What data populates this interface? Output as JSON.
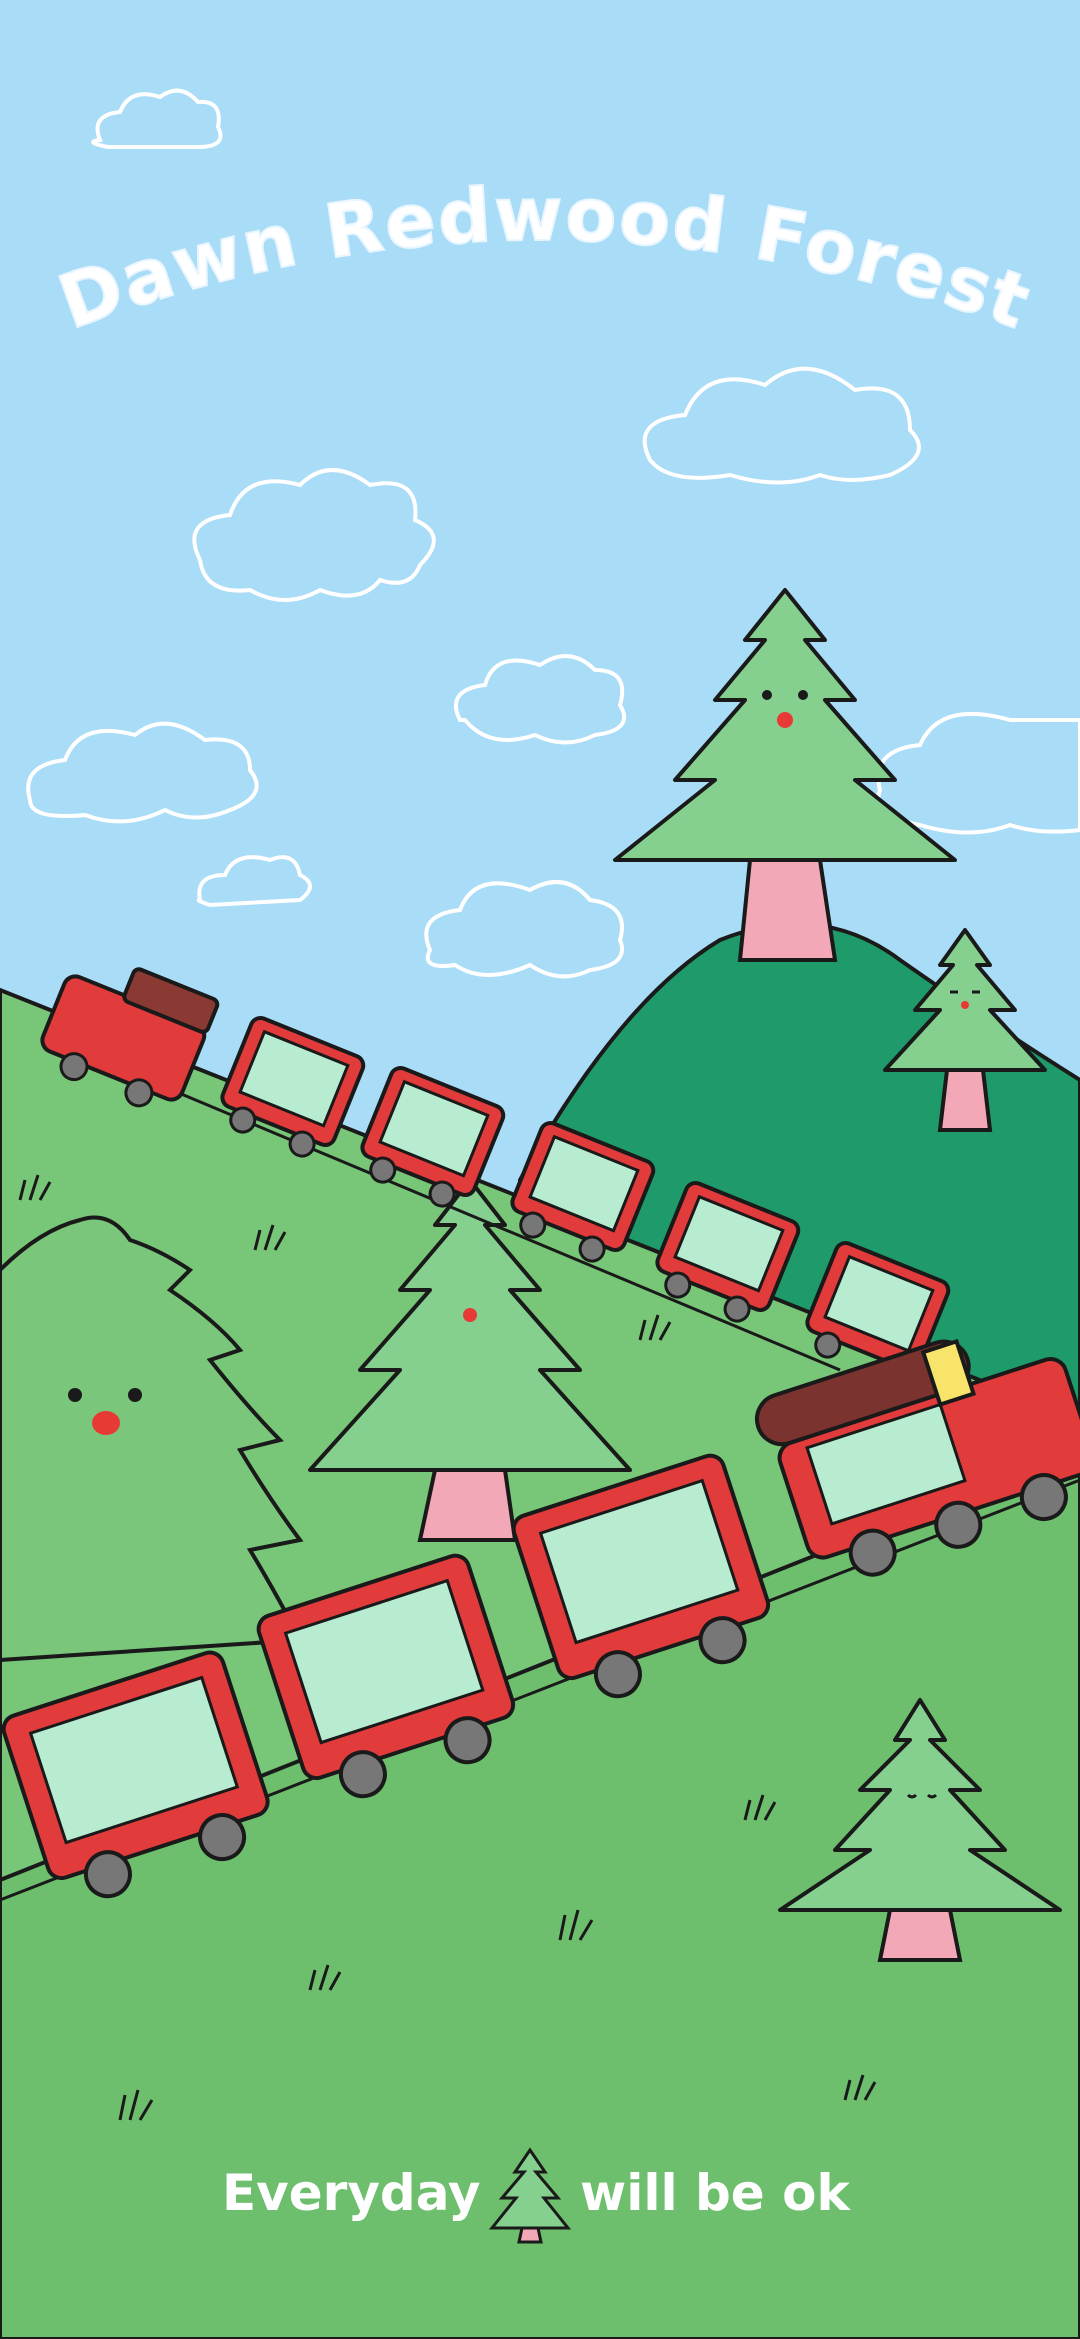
{
  "title": "Dawn Redwood Forest",
  "footer": {
    "left_text": "Everyday",
    "right_text": "will be ok"
  },
  "colors": {
    "sky": "#a9dcf7",
    "hill_light": "#78c677",
    "hill_dark": "#1f9a6a",
    "ground": "#6dbf6e",
    "tree_green": "#86d08f",
    "tree_trunk": "#f2a8b6",
    "train_red": "#e23b3b",
    "title_white": "#ffffff"
  },
  "icons": [
    "cloud-icon",
    "tree-icon",
    "train-car-icon",
    "grass-tuft-icon"
  ]
}
